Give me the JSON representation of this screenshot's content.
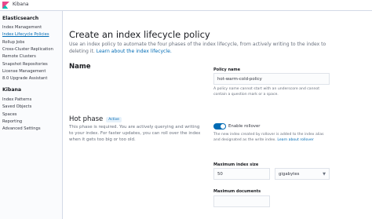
{
  "topbar": {
    "title": "Kibana"
  },
  "sidebar": {
    "groups": [
      {
        "heading": "Elasticsearch",
        "items": [
          {
            "label": "Index Management"
          },
          {
            "label": "Index Lifecycle Policies"
          },
          {
            "label": "Rollup Jobs"
          },
          {
            "label": "Cross-Cluster Replication"
          },
          {
            "label": "Remote Clusters"
          },
          {
            "label": "Snapshot Repositories"
          },
          {
            "label": "License Management"
          },
          {
            "label": "8.0 Upgrade Assistant"
          }
        ]
      },
      {
        "heading": "Kibana",
        "items": [
          {
            "label": "Index Patterns"
          },
          {
            "label": "Saved Objects"
          },
          {
            "label": "Spaces"
          },
          {
            "label": "Reporting"
          },
          {
            "label": "Advanced Settings"
          }
        ]
      }
    ]
  },
  "main": {
    "title": "Create an index lifecycle policy",
    "intro_text": "Use an index policy to automate the four phases of the index lifecycle, from actively writing to the index to deleting it.",
    "intro_link": "Learn about the index lifecycle.",
    "name_section": {
      "heading": "Name",
      "policy_label": "Policy name",
      "policy_value": "hot-warm-cold-policy",
      "policy_help": "A policy name cannot start with an underscore and cannot contain a question mark or a space."
    },
    "hot_phase": {
      "heading": "Hot phase",
      "badge": "Active",
      "description": "This phase is required. You are actively querying and writing to your index. For faster updates, you can roll over the index when it gets too big or too old.",
      "rollover_label": "Enable rollover",
      "rollover_enabled": true,
      "rollover_help": "The new index created by rollover is added to the index alias and designated as the write index.",
      "rollover_link": "Learn about rollover",
      "max_size_label": "Maximum index size",
      "max_size_value": "50",
      "max_size_unit": "gigabytes",
      "max_docs_label": "Maximum documents"
    }
  }
}
